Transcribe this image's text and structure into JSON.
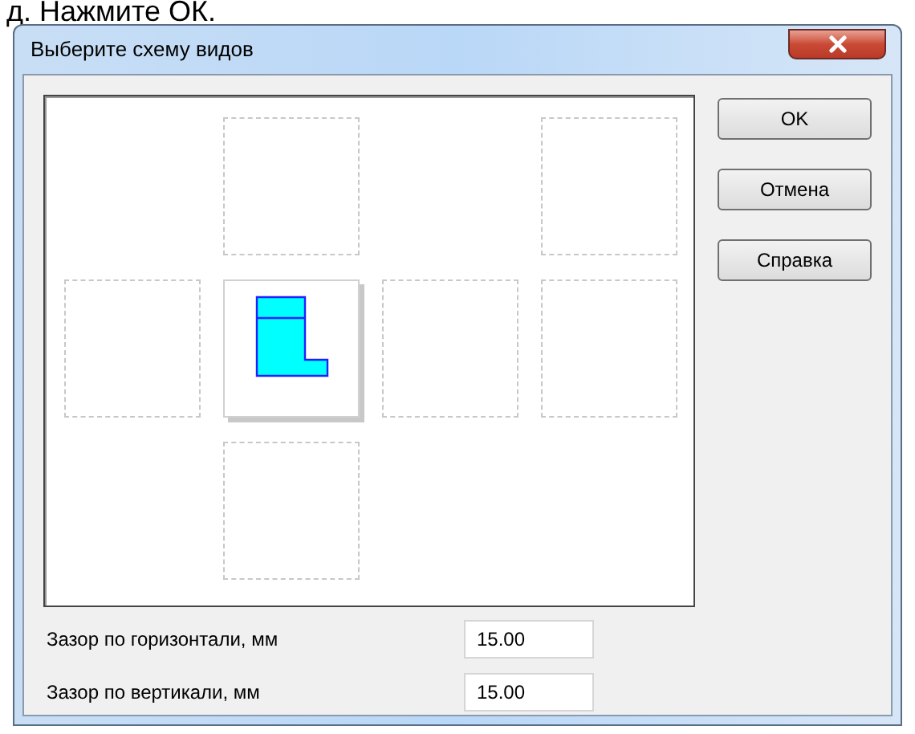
{
  "background_text": "д. Нажмите ОК.",
  "window": {
    "title": "Выберите схему видов"
  },
  "view_grid": [
    [
      {
        "kind": "none"
      },
      {
        "kind": "view",
        "selected": false
      },
      {
        "kind": "none"
      },
      {
        "kind": "view",
        "selected": false
      }
    ],
    [
      {
        "kind": "view",
        "selected": false
      },
      {
        "kind": "view",
        "selected": true
      },
      {
        "kind": "view",
        "selected": false
      },
      {
        "kind": "view",
        "selected": false
      }
    ],
    [
      {
        "kind": "none"
      },
      {
        "kind": "view",
        "selected": false
      },
      {
        "kind": "none"
      },
      {
        "kind": "none"
      }
    ]
  ],
  "buttons": [
    {
      "label": "OK"
    },
    {
      "label": "Отмена"
    },
    {
      "label": "Справка"
    }
  ],
  "fields": [
    {
      "label": "Зазор по горизонтали, мм",
      "value": "15.00"
    },
    {
      "label": "Зазор по вертикали, мм",
      "value": "15.00"
    }
  ]
}
